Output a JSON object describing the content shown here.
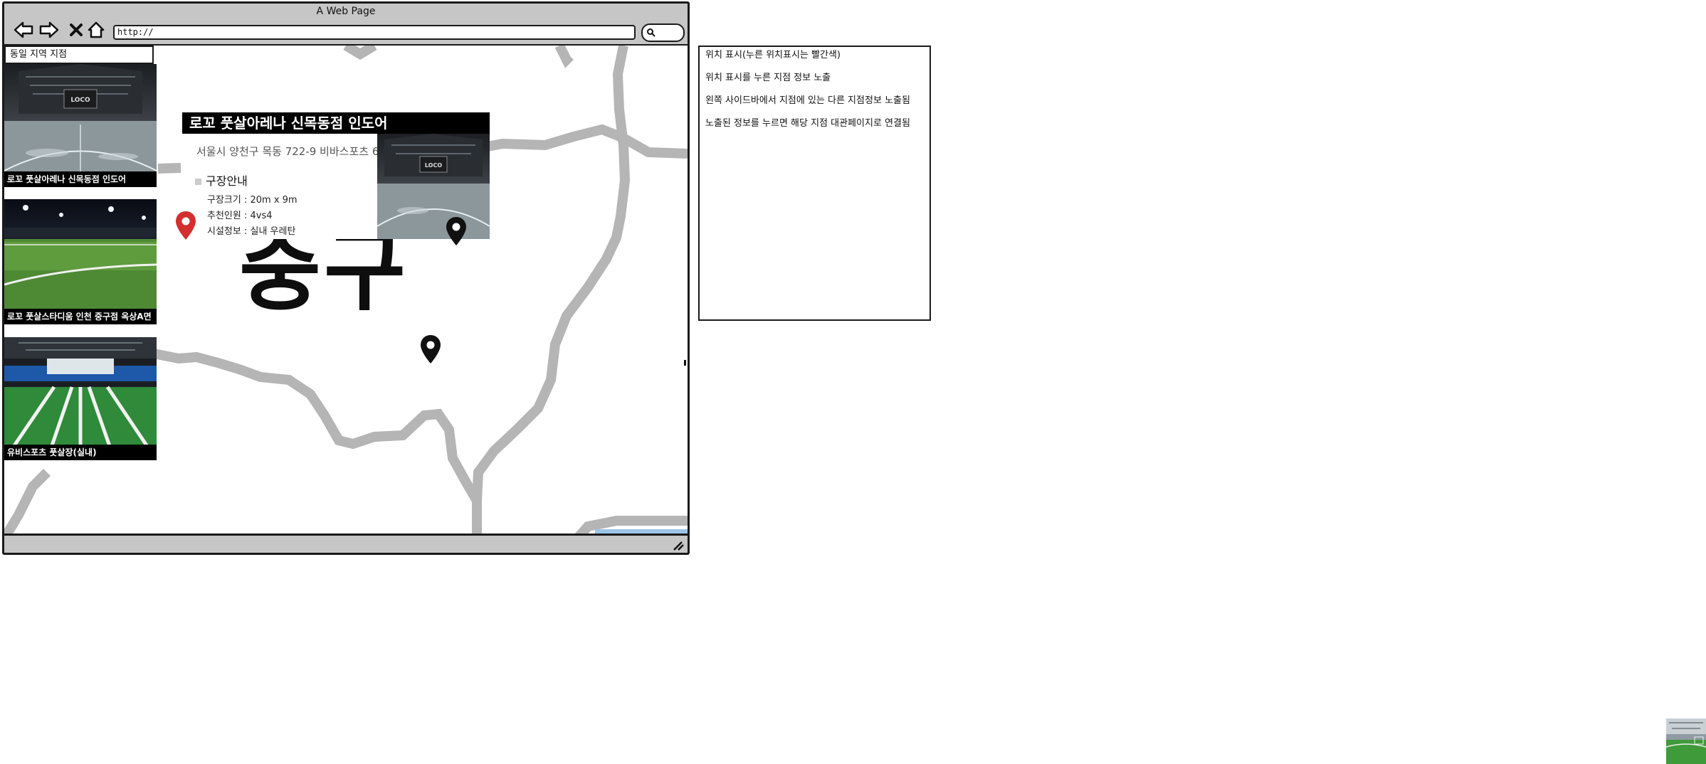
{
  "browser": {
    "window_title": "A Web Page",
    "url": "http://",
    "icons": [
      "back-arrow-icon",
      "forward-arrow-icon",
      "close-icon",
      "home-icon",
      "search-icon",
      "resize-grip-icon"
    ]
  },
  "sidebar": {
    "title": "동일 지역 지점",
    "items": [
      {
        "label": "로꼬 풋살아레나 신목동점 인도어",
        "photo": "indoor-arena-photo"
      },
      {
        "label": "로꼬 풋살스타디움 인천 중구점 옥상A면",
        "photo": "rooftop-pitch-photo"
      },
      {
        "label": "유비스포츠 풋살장(실내)",
        "photo": "indoor-turf-photo"
      }
    ]
  },
  "map": {
    "district_label": "중구",
    "pins": [
      {
        "name": "selected-location-pin",
        "color": "#d32f2f",
        "state": "selected"
      },
      {
        "name": "location-pin",
        "color": "#111111",
        "state": "default"
      },
      {
        "name": "location-pin",
        "color": "#111111",
        "state": "default"
      }
    ],
    "road_color": "#b5b5b5",
    "water_color": "#9cc4e8"
  },
  "popup": {
    "title": "로꼬 풋살아레나 신목동점 인도어",
    "address": "서울시 양천구 목동 722-9 비바스포츠 6층",
    "section_title": "구장안내",
    "size": "구장크기 : 20m x 9m",
    "players": "추천인원 : 4vs4",
    "facility": "시설정보 : 실내 우레탄"
  },
  "annotations": [
    "위치 표시(누른 위치표시는 빨간색)",
    "위치 표시를 누른 지점 정보 노출",
    "왼쪽 사이드바에서 지점에 있는 다른 지점정보 노출됨",
    "노출된 정보를 누르면 해당 지점 대관페이지로 연결됨"
  ],
  "colors": {
    "frame": "#c6c6c6",
    "selected_pin": "#d32f2f",
    "default_pin": "#111111",
    "caption_bg": "#000000"
  }
}
